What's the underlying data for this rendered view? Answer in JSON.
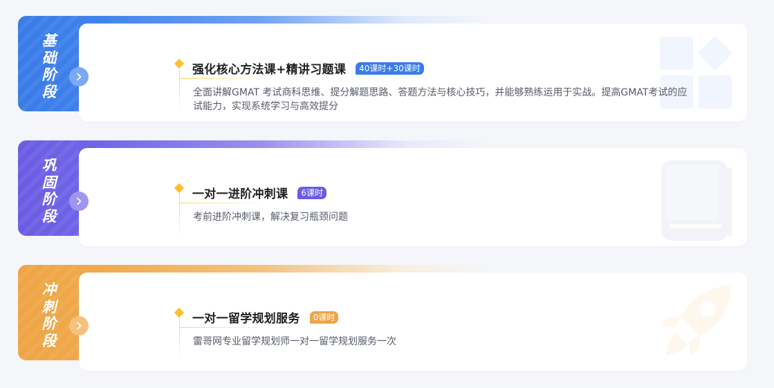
{
  "stages": [
    {
      "name": "基础阶段",
      "course_title": "强化核心方法课+精讲习题课",
      "hours": "40课时+30课时",
      "description": "全面讲解GMAT 考试商科思维、提分解题思路、答题方法与核心技巧，并能够熟练运用于实战。提高GMAT考试的应试能力，实现系统学习与高效提分",
      "accent_color": "#3a7be8",
      "icon": "blocks-icon"
    },
    {
      "name": "巩固阶段",
      "course_title": "一对一进阶冲刺课",
      "hours": "6课时",
      "description": "考前进阶冲刺课，解决复习瓶颈问题",
      "accent_color": "#6a5de3",
      "icon": "book-icon"
    },
    {
      "name": "冲刺阶段",
      "course_title": "一对一留学规划服务",
      "hours": "0课时",
      "description": "雷哥网专业留学规划师一对一留学规划服务一次",
      "accent_color": "#eea545",
      "icon": "rocket-icon"
    }
  ]
}
